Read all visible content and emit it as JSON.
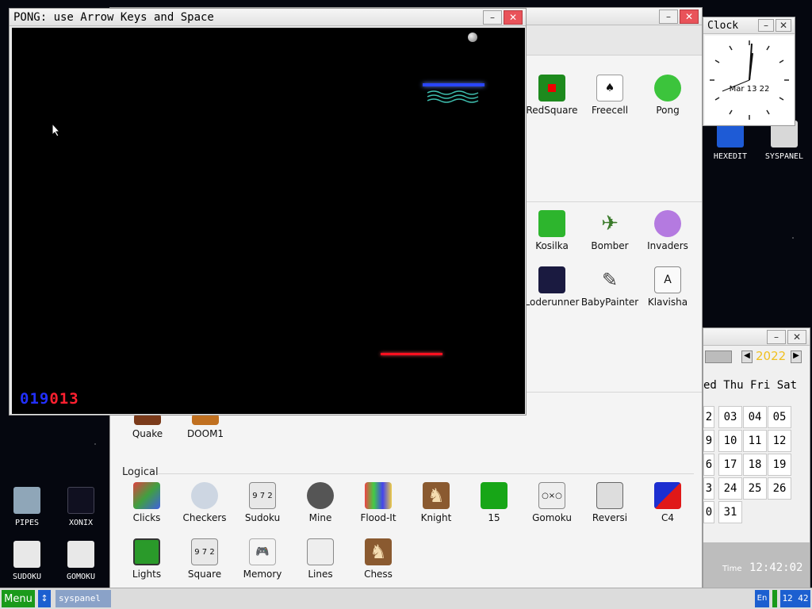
{
  "pong": {
    "title": "PONG: use Arrow Keys and Space",
    "score_left": "019",
    "score_right": "013"
  },
  "launcher": {
    "top_apps": [
      {
        "label": "RedSquare",
        "icon": "red-square-icon"
      },
      {
        "label": "Freecell",
        "icon": "freecell-icon"
      },
      {
        "label": "Pong",
        "icon": "pong-icon"
      }
    ],
    "arcade_apps": [
      {
        "label": "Kosilka",
        "icon": "lawnmower-icon"
      },
      {
        "label": "Bomber",
        "icon": "plane-icon"
      },
      {
        "label": "Invaders",
        "icon": "ufo-icon"
      },
      {
        "label": "Loderunner",
        "icon": "loderunner-icon"
      },
      {
        "label": "BabyPainter",
        "icon": "pipette-icon"
      },
      {
        "label": "Klavisha",
        "icon": "key-icon"
      }
    ],
    "shooter_apps": [
      {
        "label": "Quake",
        "icon": "quake-icon"
      },
      {
        "label": "DOOM1",
        "icon": "doom-icon"
      }
    ],
    "logical_section": "Logical",
    "logical_apps": [
      {
        "label": "Clicks",
        "icon": "clicks-icon"
      },
      {
        "label": "Checkers",
        "icon": "checkers-icon"
      },
      {
        "label": "Sudoku",
        "icon": "sudoku-icon"
      },
      {
        "label": "Mine",
        "icon": "mine-icon"
      },
      {
        "label": "Flood-It",
        "icon": "flood-it-icon"
      },
      {
        "label": "Knight",
        "icon": "knight-icon"
      },
      {
        "label": "15",
        "icon": "fifteen-icon"
      },
      {
        "label": "Gomoku",
        "icon": "gomoku-icon"
      },
      {
        "label": "Reversi",
        "icon": "reversi-icon"
      },
      {
        "label": "C4",
        "icon": "c4-icon"
      },
      {
        "label": "Lights",
        "icon": "lights-icon"
      },
      {
        "label": "Square",
        "icon": "square-icon"
      },
      {
        "label": "Memory",
        "icon": "memory-icon"
      },
      {
        "label": "Lines",
        "icon": "lines-icon"
      },
      {
        "label": "Chess",
        "icon": "chess-icon"
      }
    ]
  },
  "clock": {
    "title": "Clock",
    "date": "Mar 13 22"
  },
  "calendar": {
    "year": "2022",
    "days_header": "ed Thu Fri Sat",
    "rows": [
      [
        "2",
        "03",
        "04",
        "05"
      ],
      [
        "9",
        "10",
        "11",
        "12"
      ],
      [
        "6",
        "17",
        "18",
        "19"
      ],
      [
        "3",
        "24",
        "25",
        "26"
      ],
      [
        "0",
        "31",
        "",
        ""
      ]
    ],
    "time_label": "Time",
    "time_value": "12:42:02"
  },
  "desktop_icons": [
    {
      "label": "HEXEDIT",
      "icon": "hexedit-icon"
    },
    {
      "label": "SYSPANEL",
      "icon": "syspanel-icon"
    },
    {
      "label": "PIPES",
      "icon": "pipes-icon"
    },
    {
      "label": "XONIX",
      "icon": "xonix-icon"
    },
    {
      "label": "SUDOKU",
      "icon": "sudoku-desktop-icon"
    },
    {
      "label": "GOMOKU",
      "icon": "gomoku-desktop-icon"
    }
  ],
  "taskbar": {
    "menu_label": "Menu",
    "task_label": "syspanel",
    "lang": "En",
    "clock": "12 42"
  },
  "colors": {
    "court": "#000000",
    "left_paddle": "#2a46ff",
    "right_paddle": "#ff1020",
    "score_blue": "#2230ff",
    "score_red": "#ff2030",
    "menu_green": "#1a9a1a",
    "taskbar_blue": "#1c5fd0",
    "calendar_year": "#f0c020"
  }
}
